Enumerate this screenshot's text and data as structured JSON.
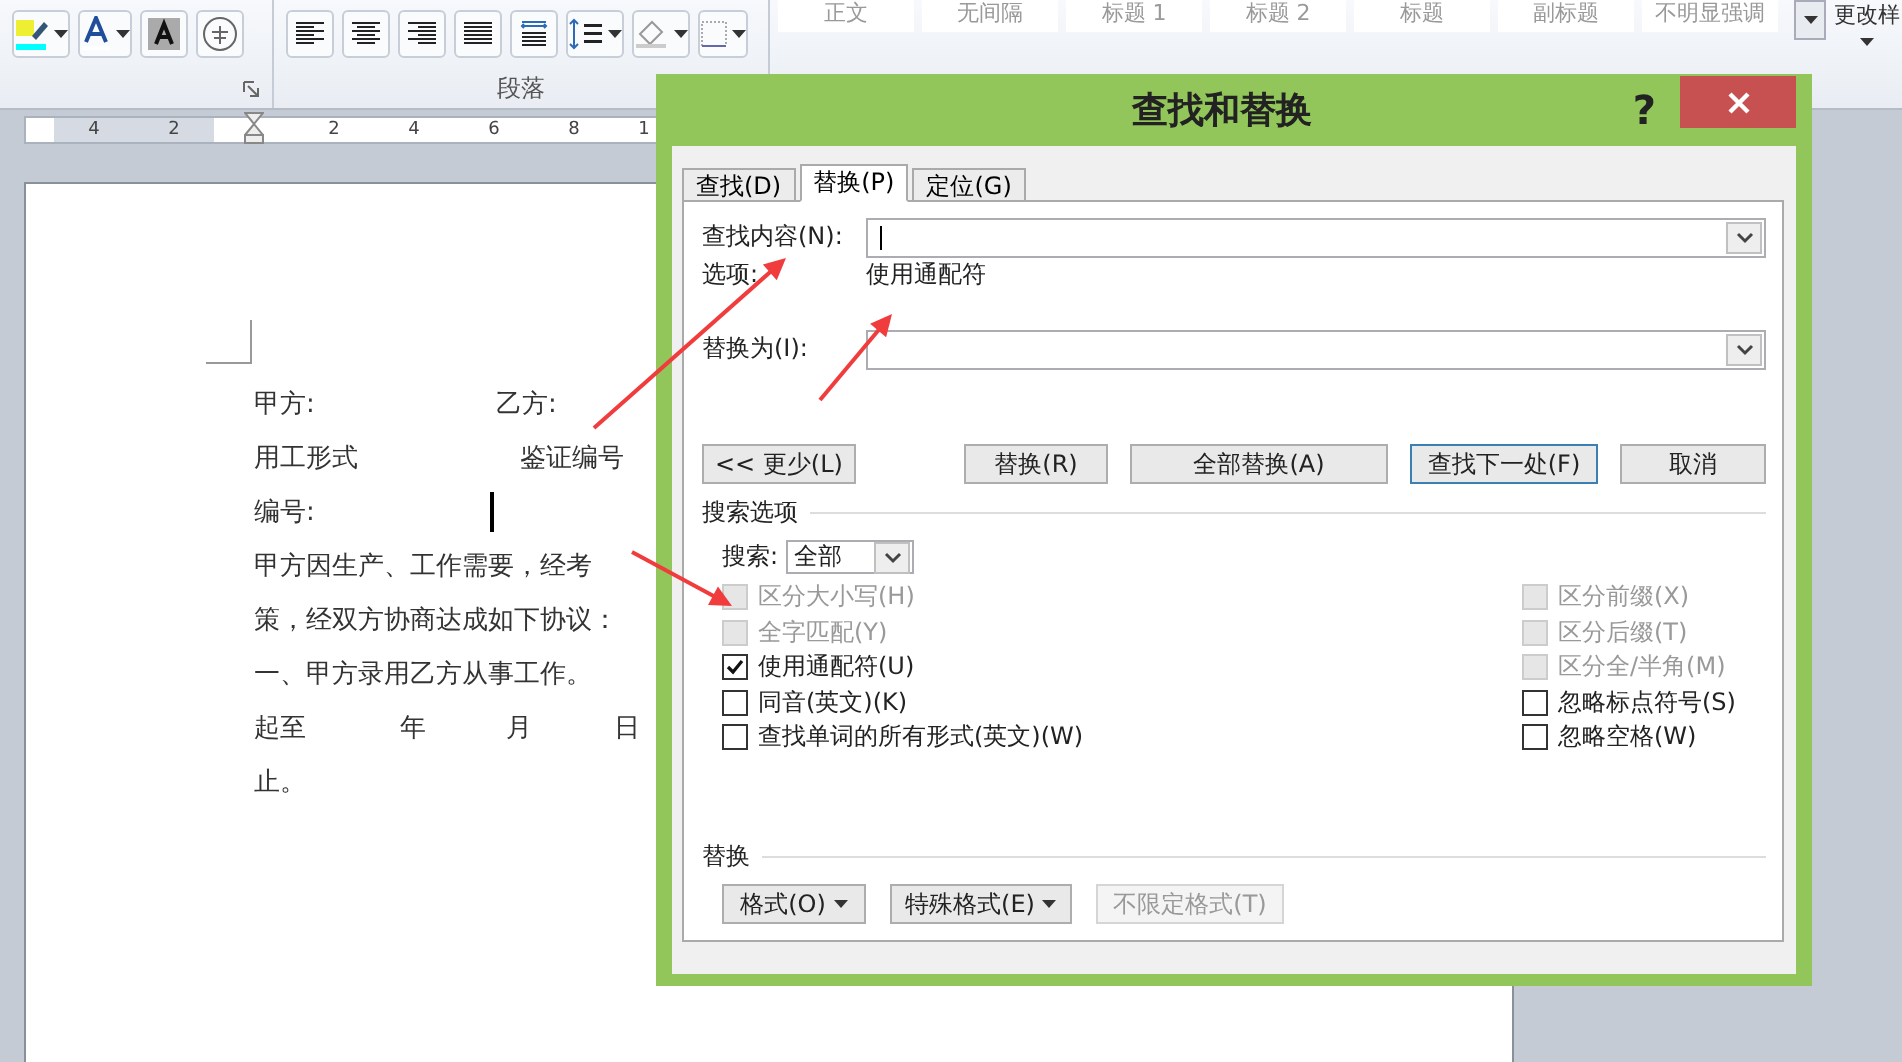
{
  "ribbon": {
    "paragraph_group": {
      "label": "段落"
    },
    "styles": [
      {
        "label": "正文"
      },
      {
        "label": "无间隔"
      },
      {
        "label": "标题 1"
      },
      {
        "label": "标题 2"
      },
      {
        "label": "标题"
      },
      {
        "label": "副标题"
      },
      {
        "label": "不明显强调"
      }
    ],
    "change_styles": "更改样"
  },
  "ruler": {
    "labels": [
      "4",
      "2",
      "2",
      "4",
      "6",
      "8",
      "1"
    ]
  },
  "document": {
    "lines": [
      [
        "甲方:",
        "乙方:"
      ],
      [
        "用工形式",
        "鉴证编号"
      ],
      [
        "编号:"
      ],
      [
        "甲方因生产、工作需要，经考"
      ],
      [
        "策，经双方协商达成如下协议："
      ],
      [
        "一、甲方录用乙方从事工作。"
      ],
      [
        "起至",
        "年",
        "月",
        "日"
      ],
      [
        "止。"
      ]
    ]
  },
  "dialog": {
    "title": "查找和替换",
    "help": "?",
    "tabs": [
      {
        "label": "查找(D)",
        "selected": false
      },
      {
        "label": "替换(P)",
        "selected": true
      },
      {
        "label": "定位(G)",
        "selected": false
      }
    ],
    "find_label": "查找内容(N):",
    "options_label": "选项:",
    "options_value": "使用通配符",
    "replace_label": "替换为(I):",
    "buttons": [
      {
        "label": "<< 更少(L)",
        "default": false
      },
      {
        "label": "替换(R)",
        "default": false
      },
      {
        "label": "全部替换(A)",
        "default": false
      },
      {
        "label": "查找下一处(F)",
        "default": true
      },
      {
        "label": "取消",
        "default": false
      }
    ],
    "search_options": {
      "title": "搜索选项",
      "search_label": "搜索:",
      "search_value": "全部",
      "left": [
        {
          "label": "区分大小写(H)",
          "checked": false,
          "disabled": true
        },
        {
          "label": "全字匹配(Y)",
          "checked": false,
          "disabled": true
        },
        {
          "label": "使用通配符(U)",
          "checked": true,
          "disabled": false
        },
        {
          "label": "同音(英文)(K)",
          "checked": false,
          "disabled": false
        },
        {
          "label": "查找单词的所有形式(英文)(W)",
          "checked": false,
          "disabled": false
        }
      ],
      "right": [
        {
          "label": "区分前缀(X)",
          "checked": false,
          "disabled": true
        },
        {
          "label": "区分后缀(T)",
          "checked": false,
          "disabled": true
        },
        {
          "label": "区分全/半角(M)",
          "checked": false,
          "disabled": true
        },
        {
          "label": "忽略标点符号(S)",
          "checked": false,
          "disabled": false
        },
        {
          "label": "忽略空格(W)",
          "checked": false,
          "disabled": false
        }
      ]
    },
    "replace_section": {
      "title": "替换",
      "buttons": [
        {
          "label": "格式(O)",
          "kind": "dropdown",
          "disabled": false
        },
        {
          "label": "特殊格式(E)",
          "kind": "dropdown",
          "disabled": false
        },
        {
          "label": "不限定格式(T)",
          "kind": "plain",
          "disabled": true
        }
      ]
    }
  }
}
